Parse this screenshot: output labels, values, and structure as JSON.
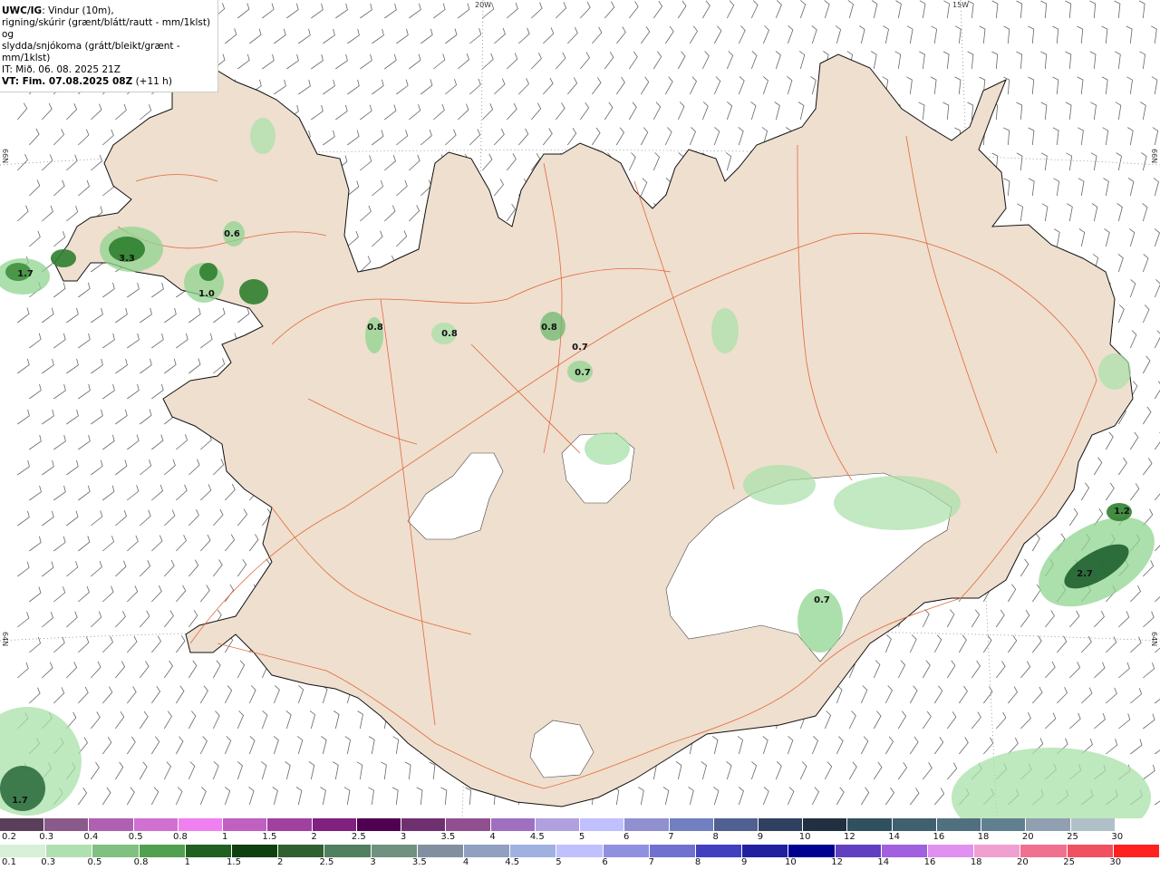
{
  "header": {
    "model": "UWC/IG",
    "line1_rest": ": Vindur (10m),",
    "line2": "rigning/skúrir (grænt/blátt/rautt - mm/1klst) og",
    "line3": "slydda/snjókoma (grátt/bleikt/grænt - mm/1klst)",
    "it": "IT: Mið. 06. 08. 2025 21Z",
    "vt_label": "VT: Fim. 07.08.2025 08Z",
    "vt_offset": "(+11 h)"
  },
  "graticule": {
    "lon_20w": "20W",
    "lon_15w": "15W",
    "lat_66n_left": "66N",
    "lat_66n_right": "66N",
    "lat_64n_left": "64N",
    "lat_64n_right": "64N"
  },
  "precip_labels": [
    {
      "text": "1.7"
    },
    {
      "text": "3.3"
    },
    {
      "text": "0.6"
    },
    {
      "text": "1.0"
    },
    {
      "text": "0.8"
    },
    {
      "text": "0.8"
    },
    {
      "text": "0.8"
    },
    {
      "text": "0.7"
    },
    {
      "text": "0.7"
    },
    {
      "text": "1.2"
    },
    {
      "text": "2.7"
    },
    {
      "text": "0.7"
    },
    {
      "text": "1.7"
    }
  ],
  "legend_snow": {
    "labels": [
      "0.2",
      "0.3",
      "0.4",
      "0.5",
      "0.8",
      "1",
      "1.5",
      "2",
      "2.5",
      "3",
      "3.5",
      "4",
      "4.5",
      "5",
      "6",
      "7",
      "8",
      "9",
      "10",
      "12",
      "14",
      "16",
      "18",
      "20",
      "25",
      "30"
    ],
    "colors": [
      "#5a3f5a",
      "#8a5a8a",
      "#b060b0",
      "#d070d0",
      "#f080f0",
      "#c060c0",
      "#a040a0",
      "#802080",
      "#500050",
      "#703070",
      "#905090",
      "#a070c0",
      "#b0a0e0",
      "#c0c0ff",
      "#9090d0",
      "#7080c0",
      "#506090",
      "#304060",
      "#203040",
      "#305060",
      "#406070",
      "#507080",
      "#608090",
      "#90a0b0",
      "#b0c0c8",
      "#ffffff"
    ]
  },
  "legend_rain": {
    "labels": [
      "0.1",
      "0.3",
      "0.5",
      "0.8",
      "1",
      "1.5",
      "2",
      "2.5",
      "3",
      "3.5",
      "4",
      "4.5",
      "5",
      "6",
      "7",
      "8",
      "9",
      "10",
      "12",
      "14",
      "16",
      "18",
      "20",
      "25",
      "30"
    ],
    "colors": [
      "#d8f0d8",
      "#b0e0b0",
      "#80c080",
      "#50a050",
      "#206020",
      "#104010",
      "#306030",
      "#508060",
      "#709080",
      "#8090a0",
      "#90a0c0",
      "#a0b0e0",
      "#c0c0ff",
      "#9090e0",
      "#7070d0",
      "#4040c0",
      "#2020a0",
      "#000090",
      "#6040c0",
      "#a060e0",
      "#e090f0",
      "#f0a0d0",
      "#f07090",
      "#f05060",
      "#ff2020"
    ]
  }
}
